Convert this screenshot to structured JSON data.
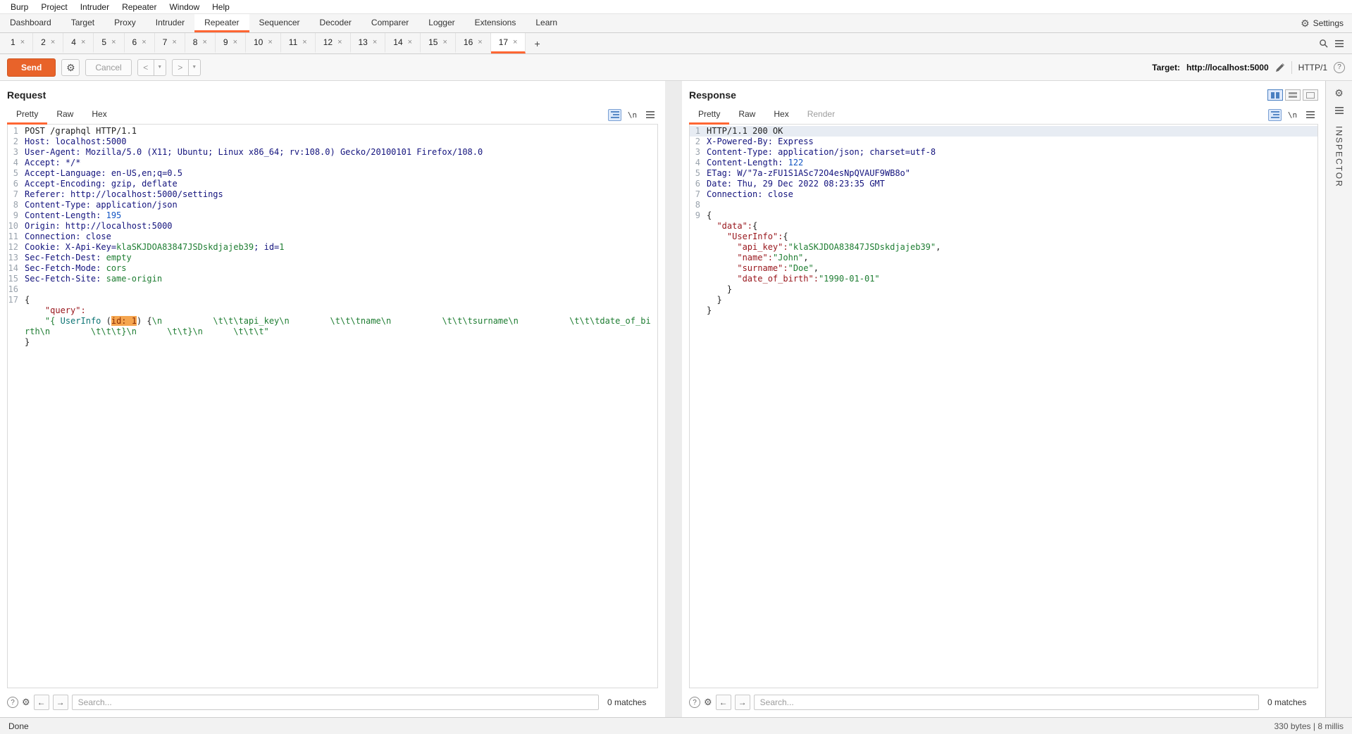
{
  "colors": {
    "accent": "#ff6633",
    "send-bg": "#e8632a",
    "blue-sel": "#4a7fc1",
    "sel-line": "#e7ecf3",
    "tok-name": "#13137d",
    "tok-value": "#13137d",
    "tok-green": "#1e7d32",
    "tok-blue": "#1256c4",
    "tok-key": "#98151b",
    "tok-string": "#1e7d32",
    "tok-teal": "#0e7575",
    "hl-bg": "#f5a54f",
    "hl-fg": "#8a2c04"
  },
  "menubar": {
    "items": [
      "Burp",
      "Project",
      "Intruder",
      "Repeater",
      "Window",
      "Help"
    ]
  },
  "main_tabs": {
    "items": [
      {
        "label": "Dashboard",
        "selected": false
      },
      {
        "label": "Target",
        "selected": false
      },
      {
        "label": "Proxy",
        "selected": false
      },
      {
        "label": "Intruder",
        "selected": false
      },
      {
        "label": "Repeater",
        "selected": true
      },
      {
        "label": "Sequencer",
        "selected": false
      },
      {
        "label": "Decoder",
        "selected": false
      },
      {
        "label": "Comparer",
        "selected": false
      },
      {
        "label": "Logger",
        "selected": false
      },
      {
        "label": "Extensions",
        "selected": false
      },
      {
        "label": "Learn",
        "selected": false
      }
    ],
    "settings_label": "Settings"
  },
  "repeater_tabs": {
    "tabs": [
      {
        "label": "1"
      },
      {
        "label": "2"
      },
      {
        "label": "4"
      },
      {
        "label": "5"
      },
      {
        "label": "6"
      },
      {
        "label": "7"
      },
      {
        "label": "8"
      },
      {
        "label": "9"
      },
      {
        "label": "10"
      },
      {
        "label": "11"
      },
      {
        "label": "12"
      },
      {
        "label": "13"
      },
      {
        "label": "14"
      },
      {
        "label": "15"
      },
      {
        "label": "16"
      },
      {
        "label": "17",
        "selected": true
      }
    ],
    "close_glyph": "×",
    "add_label": "+"
  },
  "toolbar": {
    "send_label": "Send",
    "cancel_label": "Cancel",
    "back_label": "<",
    "forward_label": ">",
    "dropdown_glyph": "▼",
    "target_label": "Target:",
    "target_url": "http://localhost:5000",
    "http_version": "HTTP/1",
    "help_glyph": "?"
  },
  "request_panel": {
    "title": "Request",
    "tabs": [
      {
        "label": "Pretty",
        "selected": true
      },
      {
        "label": "Raw"
      },
      {
        "label": "Hex"
      }
    ],
    "newline_button": "\\n",
    "search": {
      "placeholder": "Search...",
      "matches": "0 matches",
      "help_glyph": "?"
    },
    "lines": [
      {
        "n": "1",
        "seg": [
          [
            "POST /graphql HTTP/1.1",
            "t"
          ]
        ]
      },
      {
        "n": "2",
        "seg": [
          [
            "Host:",
            "n"
          ],
          [
            " localhost:5000",
            "v"
          ]
        ]
      },
      {
        "n": "3",
        "seg": [
          [
            "User-Agent:",
            "n"
          ],
          [
            " Mozilla/5.0 (X11; Ubuntu; Linux x86_64; rv:108.0) Gecko/20100101 Firefox/108.0",
            "v"
          ]
        ]
      },
      {
        "n": "4",
        "seg": [
          [
            "Accept:",
            "n"
          ],
          [
            " */*",
            "v"
          ]
        ]
      },
      {
        "n": "5",
        "seg": [
          [
            "Accept-Language:",
            "n"
          ],
          [
            " en-US,en;q=0.5",
            "v"
          ]
        ]
      },
      {
        "n": "6",
        "seg": [
          [
            "Accept-Encoding:",
            "n"
          ],
          [
            " gzip, deflate",
            "v"
          ]
        ]
      },
      {
        "n": "7",
        "seg": [
          [
            "Referer:",
            "n"
          ],
          [
            " http://localhost:5000/settings",
            "v"
          ]
        ]
      },
      {
        "n": "8",
        "seg": [
          [
            "Content-Type:",
            "n"
          ],
          [
            " application/json",
            "v"
          ]
        ]
      },
      {
        "n": "9",
        "seg": [
          [
            "Content-Length:",
            "n"
          ],
          [
            " 195",
            "b"
          ]
        ]
      },
      {
        "n": "10",
        "seg": [
          [
            "Origin:",
            "n"
          ],
          [
            " http://localhost:5000",
            "v"
          ]
        ]
      },
      {
        "n": "11",
        "seg": [
          [
            "Connection:",
            "n"
          ],
          [
            " close",
            "v"
          ]
        ]
      },
      {
        "n": "12",
        "seg": [
          [
            "Cookie:",
            "n"
          ],
          [
            " X-Api-Key=",
            "v"
          ],
          [
            "klaSKJDOA83847JSDskdjajeb39",
            "g"
          ],
          [
            "; id=",
            "v"
          ],
          [
            "1",
            "g"
          ]
        ]
      },
      {
        "n": "13",
        "seg": [
          [
            "Sec-Fetch-Dest:",
            "n"
          ],
          [
            " empty",
            "g"
          ]
        ]
      },
      {
        "n": "14",
        "seg": [
          [
            "Sec-Fetch-Mode:",
            "n"
          ],
          [
            " cors",
            "g"
          ]
        ]
      },
      {
        "n": "15",
        "seg": [
          [
            "Sec-Fetch-Site:",
            "n"
          ],
          [
            " same-origin",
            "g"
          ]
        ]
      },
      {
        "n": "16",
        "seg": []
      },
      {
        "n": "17",
        "seg": [
          [
            "{",
            "t"
          ]
        ]
      },
      {
        "n": "",
        "seg": [
          [
            "    \"query\":",
            "k"
          ]
        ]
      },
      {
        "n": "",
        "seg": [
          [
            "    \"{ ",
            "s"
          ],
          [
            "UserInfo",
            "teal"
          ],
          [
            " (",
            "t"
          ],
          [
            "id: 1",
            "hl"
          ],
          [
            ") {",
            "t"
          ],
          [
            "\\n          \\t\\t\\tapi_key\\n        \\t\\t\\tname\\n          \\t\\t\\tsurname\\n          \\t\\t\\tdate_of_birth\\n        \\t\\t\\t}\\n      \\t\\t}\\n      \\t\\t\\t\"",
            "s"
          ]
        ]
      },
      {
        "n": "",
        "seg": [
          [
            "}",
            "t"
          ]
        ]
      }
    ]
  },
  "response_panel": {
    "title": "Response",
    "tabs": [
      {
        "label": "Pretty",
        "selected": true
      },
      {
        "label": "Raw"
      },
      {
        "label": "Hex"
      },
      {
        "label": "Render",
        "muted": true
      }
    ],
    "newline_button": "\\n",
    "search": {
      "placeholder": "Search...",
      "matches": "0 matches",
      "help_glyph": "?"
    },
    "lines": [
      {
        "n": "1",
        "sel": true,
        "seg": [
          [
            "HTTP/1.1 200 OK",
            "t"
          ]
        ]
      },
      {
        "n": "2",
        "seg": [
          [
            "X-Powered-By:",
            "n"
          ],
          [
            " Express",
            "v"
          ]
        ]
      },
      {
        "n": "3",
        "seg": [
          [
            "Content-Type:",
            "n"
          ],
          [
            " application/json; charset=utf-8",
            "v"
          ]
        ]
      },
      {
        "n": "4",
        "seg": [
          [
            "Content-Length:",
            "n"
          ],
          [
            " 122",
            "b"
          ]
        ]
      },
      {
        "n": "5",
        "seg": [
          [
            "ETag:",
            "n"
          ],
          [
            " W/\"7a-zFU1S1ASc72O4esNpQVAUF9WB8o\"",
            "v"
          ]
        ]
      },
      {
        "n": "6",
        "seg": [
          [
            "Date:",
            "n"
          ],
          [
            " Thu, 29 Dec 2022 08:23:35 GMT",
            "v"
          ]
        ]
      },
      {
        "n": "7",
        "seg": [
          [
            "Connection:",
            "n"
          ],
          [
            " close",
            "v"
          ]
        ]
      },
      {
        "n": "8",
        "seg": []
      },
      {
        "n": "9",
        "seg": [
          [
            "{",
            "t"
          ]
        ]
      },
      {
        "n": "",
        "seg": [
          [
            "  \"data\":",
            "k"
          ],
          [
            "{",
            "t"
          ]
        ]
      },
      {
        "n": "",
        "seg": [
          [
            "    \"UserInfo\":",
            "k"
          ],
          [
            "{",
            "t"
          ]
        ]
      },
      {
        "n": "",
        "seg": [
          [
            "      \"api_key\":",
            "k"
          ],
          [
            "\"klaSKJDOA83847JSDskdjajeb39\"",
            "s"
          ],
          [
            ",",
            "t"
          ]
        ]
      },
      {
        "n": "",
        "seg": [
          [
            "      \"name\":",
            "k"
          ],
          [
            "\"John\"",
            "s"
          ],
          [
            ",",
            "t"
          ]
        ]
      },
      {
        "n": "",
        "seg": [
          [
            "      \"surname\":",
            "k"
          ],
          [
            "\"Doe\"",
            "s"
          ],
          [
            ",",
            "t"
          ]
        ]
      },
      {
        "n": "",
        "seg": [
          [
            "      \"date_of_birth\":",
            "k"
          ],
          [
            "\"1990-01-01\"",
            "s"
          ]
        ]
      },
      {
        "n": "",
        "seg": [
          [
            "    }",
            "t"
          ]
        ]
      },
      {
        "n": "",
        "seg": [
          [
            "  }",
            "t"
          ]
        ]
      },
      {
        "n": "",
        "seg": [
          [
            "}",
            "t"
          ]
        ]
      }
    ]
  },
  "inspector": {
    "label": "INSPECTOR"
  },
  "status_bar": {
    "left": "Done",
    "right": "330 bytes | 8 millis"
  }
}
